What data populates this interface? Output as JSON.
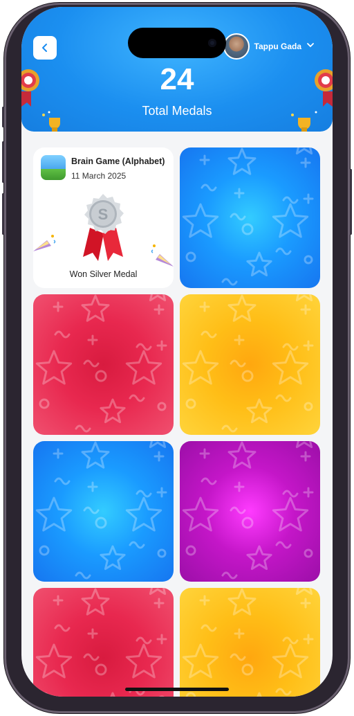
{
  "header": {
    "count": "24",
    "count_label": "Total Medals",
    "user_name": "Tappu Gada"
  },
  "medals": [
    {
      "game": "Brain Game (Alphabet)",
      "date": "11 March 2025",
      "medal": "S",
      "status": "Won Silver Medal",
      "state": "revealed"
    },
    {
      "state": "hidden",
      "color": "blue"
    },
    {
      "state": "hidden",
      "color": "red"
    },
    {
      "state": "hidden",
      "color": "yellow"
    },
    {
      "state": "hidden",
      "color": "blue"
    },
    {
      "state": "hidden",
      "color": "purple"
    },
    {
      "state": "hidden",
      "color": "red"
    },
    {
      "state": "hidden",
      "color": "yellow"
    }
  ],
  "colors": {
    "header_blue": "#1b8ff0",
    "silver": "#c8cdd2",
    "ribbon_red": "#e3142a"
  },
  "icons": [
    "back-chevron-icon",
    "chevron-down-icon",
    "silver-medal-icon",
    "trophy-icon",
    "party-popper-icon"
  ]
}
